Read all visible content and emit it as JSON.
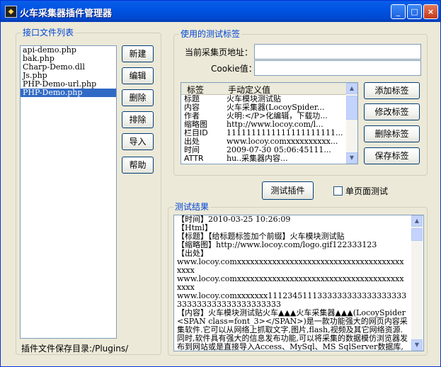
{
  "window": {
    "title": "火车采集器插件管理器",
    "minimize": "_",
    "maximize": "□",
    "close": "×"
  },
  "interface_group": {
    "legend": "接口文件列表",
    "files": [
      "api-demo.php",
      "bak.php",
      "Charp-Demo.dll",
      "Js.php",
      "PHP-Demo-url.php",
      "PHP-Demo.php"
    ],
    "selected_index": 5,
    "buttons": {
      "new": "新建",
      "edit": "编辑",
      "delete": "删除",
      "sort": "排除",
      "import": "导入",
      "help": "帮助"
    },
    "plugin_dir_label": "插件文件保存目录:/Plugins/"
  },
  "tag_group": {
    "legend": "使用的测试标签",
    "url_label": "当前采集页地址：",
    "url_value": "",
    "cookie_label": "Cookie值：",
    "cookie_value": "",
    "grid_headers": [
      "标签",
      "手动定义值"
    ],
    "rows": [
      [
        "标题",
        "火车模块测试贴"
      ],
      [
        "内容",
        "火车采集器(LocoySpider..."
      ],
      [
        "作者",
        "火明:</P>化编辑，下载功..."
      ],
      [
        "缩略图",
        "http://www.locoy.com/l..."
      ],
      [
        "栏目ID",
        "1111111111111111111111..."
      ],
      [
        "出处",
        "www.locoy.comxxxxxxxxxx..."
      ],
      [
        "时间",
        "2009-07-30 05:06:45111..."
      ],
      [
        "ATTR",
        "hu..采集器内容..."
      ]
    ],
    "buttons": {
      "add": "添加标签",
      "modify": "修改标签",
      "delete": "删除标签",
      "save": "保存标签"
    }
  },
  "test_button": "测试插件",
  "single_page": {
    "label": "单页面测试",
    "checked": false
  },
  "result_group": {
    "legend": "测试结果",
    "lines": [
      "【时间】2010-03-25 10:26:09",
      "【Html】",
      "【标题】【给标题标签加个前缀】火车模块测试贴",
      "【缩略图】http://www.locoy.com/logo.gif122333123",
      "【出处】",
      "www.locoy.comxxxxxxxxxxxxxxxxxxxxxxxxxxxxxxxxxxxxxxxxxx",
      "www.locoy.comxxxxxxxxxxxxxxxxxxxxxxxxxxxxxxxxxxxxxxxxxx",
      "www.locoy.comxxxxxxx1112345111333333333333333333333333333333333333333",
      "【内容】火车模块测试贴火车▲▲▲火车采集器▲▲▲(LocoySpider<SPAN class=font_3></SPAN>)是一款功能强大的网页内容采集软件.它可以从网络上抓取文字,图片,flash,视频及其它网络资源.同时,软件具有强大的信息发布功能,可以将采集的数据模仿浏览器发布到网站或是直接导入Access、MySql、MS SqlServer数据库,还可以保存为本地文件,方便浏览使火车"
    ]
  }
}
